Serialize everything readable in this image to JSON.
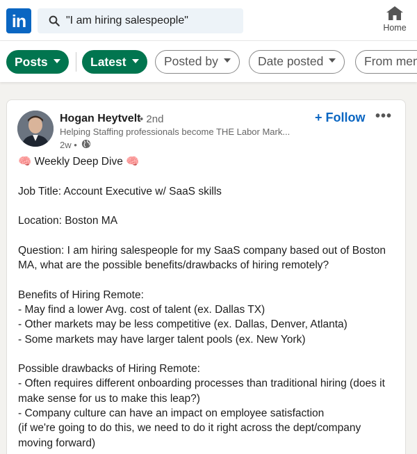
{
  "search": {
    "query": "\"I am hiring salespeople\""
  },
  "nav": {
    "logo": "in",
    "home_label": "Home"
  },
  "filters": [
    {
      "label": "Posts",
      "active": true
    },
    {
      "label": "Latest",
      "active": true
    },
    {
      "label": "Posted by",
      "active": false
    },
    {
      "label": "Date posted",
      "active": false
    },
    {
      "label": "From mem",
      "active": false
    }
  ],
  "post": {
    "author": "Hogan Heytvelt",
    "degree": "• 2nd",
    "headline": "Helping Staffing professionals become THE Labor Mark...",
    "age": "2w •",
    "follow_label": "+ Follow",
    "more_label": "•••",
    "lines": [
      "🧠 Weekly Deep Dive 🧠",
      "",
      "Job Title: Account Executive w/ SaaS skills",
      "",
      "Location: Boston MA",
      "",
      "Question: I am hiring salespeople for my SaaS company based out of Boston",
      "MA, what are the possible benefits/drawbacks of hiring remotely?",
      "",
      "Benefits of Hiring Remote:",
      "- May find a lower Avg. cost of talent (ex. Dallas TX)",
      "- Other markets may be less competitive (ex. Dallas, Denver, Atlanta)",
      "- Some markets may have larger talent pools (ex. New York)",
      "",
      "Possible drawbacks of Hiring Remote:",
      "- Often requires different onboarding processes than traditional hiring (does it",
      "make sense for us to make this leap?)",
      "- Company culture can have an impact on employee satisfaction",
      "(if we're going to do this, we need to do it right across the dept/company",
      "moving forward)"
    ]
  },
  "colors": {
    "brand": "#0a66c2",
    "pill_active": "#01754f"
  }
}
